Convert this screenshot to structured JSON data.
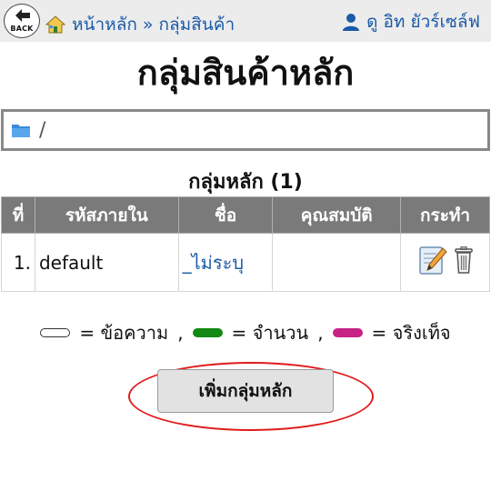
{
  "topbar": {
    "back_label": "BACK",
    "breadcrumb": {
      "home": "หน้าหลัก",
      "separator": "»",
      "current": "กลุ่มสินค้า"
    },
    "user_name": "ดู อิท ยัวร์เซล์ฟ"
  },
  "page": {
    "title": "กลุ่มสินค้าหลัก"
  },
  "path_bar": {
    "path": "/",
    "icon": "folder-icon"
  },
  "table": {
    "caption": "กลุ่มหลัก (1)",
    "headers": [
      "ที่",
      "รหัสภายใน",
      "ชื่อ",
      "คุณสมบัติ",
      "กระทำ"
    ],
    "rows": [
      {
        "no": "1.",
        "code": "default",
        "name": "_ไม่ระบุ",
        "attributes": "",
        "actions": [
          "edit-icon",
          "trash-icon"
        ]
      }
    ]
  },
  "legend": {
    "items": [
      {
        "label": "= ข้อความ",
        "color": "#ffffff",
        "kind": "text"
      },
      {
        "label": "= จำนวน",
        "color": "#128a12",
        "kind": "number"
      },
      {
        "label": "= จริงเท็จ",
        "color": "#c72385",
        "kind": "boolean"
      }
    ],
    "separator": ","
  },
  "actions": {
    "add_main_group": "เพิ่มกลุ่มหลัก"
  },
  "colors": {
    "link": "#1a5aa8",
    "header_bg": "#7a7a7a",
    "highlight": "#e11b1b"
  }
}
